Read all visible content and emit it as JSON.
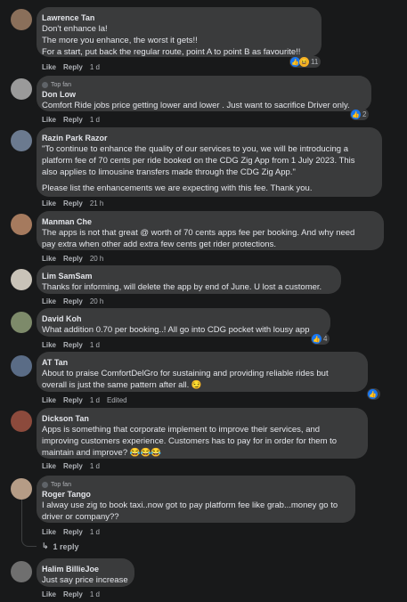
{
  "comments": [
    {
      "author": "Lawrence Tan",
      "top_fan": "",
      "lines": [
        "Don't enhance la!",
        "The more you enhance, the worst it gets!!",
        "For a start, put back the regular route, point A to point B as favourite!!"
      ],
      "like": "Like",
      "reply": "Reply",
      "time": "1 d",
      "edited": "",
      "reactions": [
        "like-icon",
        "haha-icon"
      ],
      "reaction_count": "11",
      "avatar_color": "#8a6f5a"
    },
    {
      "author": "Don Low",
      "top_fan": "Top fan",
      "lines": [
        "Comfort Ride jobs price getting lower and lower . Just want to sacrifice Driver only."
      ],
      "like": "Like",
      "reply": "Reply",
      "time": "1 d",
      "edited": "",
      "reactions": [
        "like-icon"
      ],
      "reaction_count": "2",
      "avatar_color": "#9a9a9a"
    },
    {
      "author": "Razin Park Razor",
      "top_fan": "",
      "lines": [
        "\"To continue to enhance the quality of our services to you, we will be introducing a",
        "platform fee of 70 cents per ride booked on the CDG Zig App from 1 July 2023. This",
        "also applies to limousine transfers made through the CDG Zig App.\""
      ],
      "lines2": [
        "Please list the enhancements we are expecting with this fee. Thank you."
      ],
      "like": "Like",
      "reply": "Reply",
      "time": "21 h",
      "edited": "",
      "reactions": [],
      "reaction_count": "",
      "avatar_color": "#6b7a8f"
    },
    {
      "author": "Manman Che",
      "top_fan": "",
      "lines": [
        "The apps is not that great @ worth of 70 cents apps fee per booking. And why need",
        "pay extra when other add extra few cents get rider protections."
      ],
      "like": "Like",
      "reply": "Reply",
      "time": "20 h",
      "edited": "",
      "reactions": [],
      "reaction_count": "",
      "avatar_color": "#a57a5e"
    },
    {
      "author": "Lim SamSam",
      "top_fan": "",
      "lines": [
        "Thanks for informing, will delete the app by end of June. U lost a customer."
      ],
      "like": "Like",
      "reply": "Reply",
      "time": "20 h",
      "edited": "",
      "reactions": [],
      "reaction_count": "",
      "avatar_color": "#c9c3b8"
    },
    {
      "author": "David Koh",
      "top_fan": "",
      "lines": [
        "What addition 0.70 per booking..! All go into CDG pocket with lousy app"
      ],
      "like": "Like",
      "reply": "Reply",
      "time": "1 d",
      "edited": "",
      "reactions": [
        "like-icon"
      ],
      "reaction_count": "4",
      "avatar_color": "#7d8a6a"
    },
    {
      "author": "AT Tan",
      "top_fan": "",
      "lines": [
        "About to praise ComfortDelGro for sustaining and providing reliable rides but",
        "overall is just the same pattern after all. 😏"
      ],
      "like": "Like",
      "reply": "Reply",
      "time": "1 d",
      "edited": "Edited",
      "reactions": [
        "like-icon"
      ],
      "reaction_count": "",
      "avatar_color": "#5a6c86"
    },
    {
      "author": "Dickson Tan",
      "top_fan": "",
      "lines": [
        "Apps is something that corporate implement to improve their services, and",
        "improving customers experience. Customers has to pay for in order for them to",
        "maintain and improve? 😂😂😂"
      ],
      "like": "Like",
      "reply": "Reply",
      "time": "1 d",
      "edited": "",
      "reactions": [],
      "reaction_count": "",
      "avatar_color": "#8c4a3c"
    },
    {
      "author": "Roger Tango",
      "top_fan": "Top fan",
      "lines": [
        "I alway use zig to book taxi..now got to pay platform fee like grab...money go to",
        "driver or company??"
      ],
      "like": "Like",
      "reply": "Reply",
      "time": "1 d",
      "edited": "",
      "reactions": [],
      "reaction_count": "",
      "avatar_color": "#b59c86",
      "replies_label": "1 reply"
    },
    {
      "author": "Halim BillieJoe",
      "top_fan": "",
      "lines": [
        "Just say price increase"
      ],
      "like": "Like",
      "reply": "Reply",
      "time": "1 d",
      "edited": "",
      "reactions": [],
      "reaction_count": "",
      "avatar_color": "#6f6f6f"
    }
  ],
  "colors": {
    "bubble": "#3a3b3c",
    "background": "#18191a",
    "like_blue": "#1877f2"
  }
}
